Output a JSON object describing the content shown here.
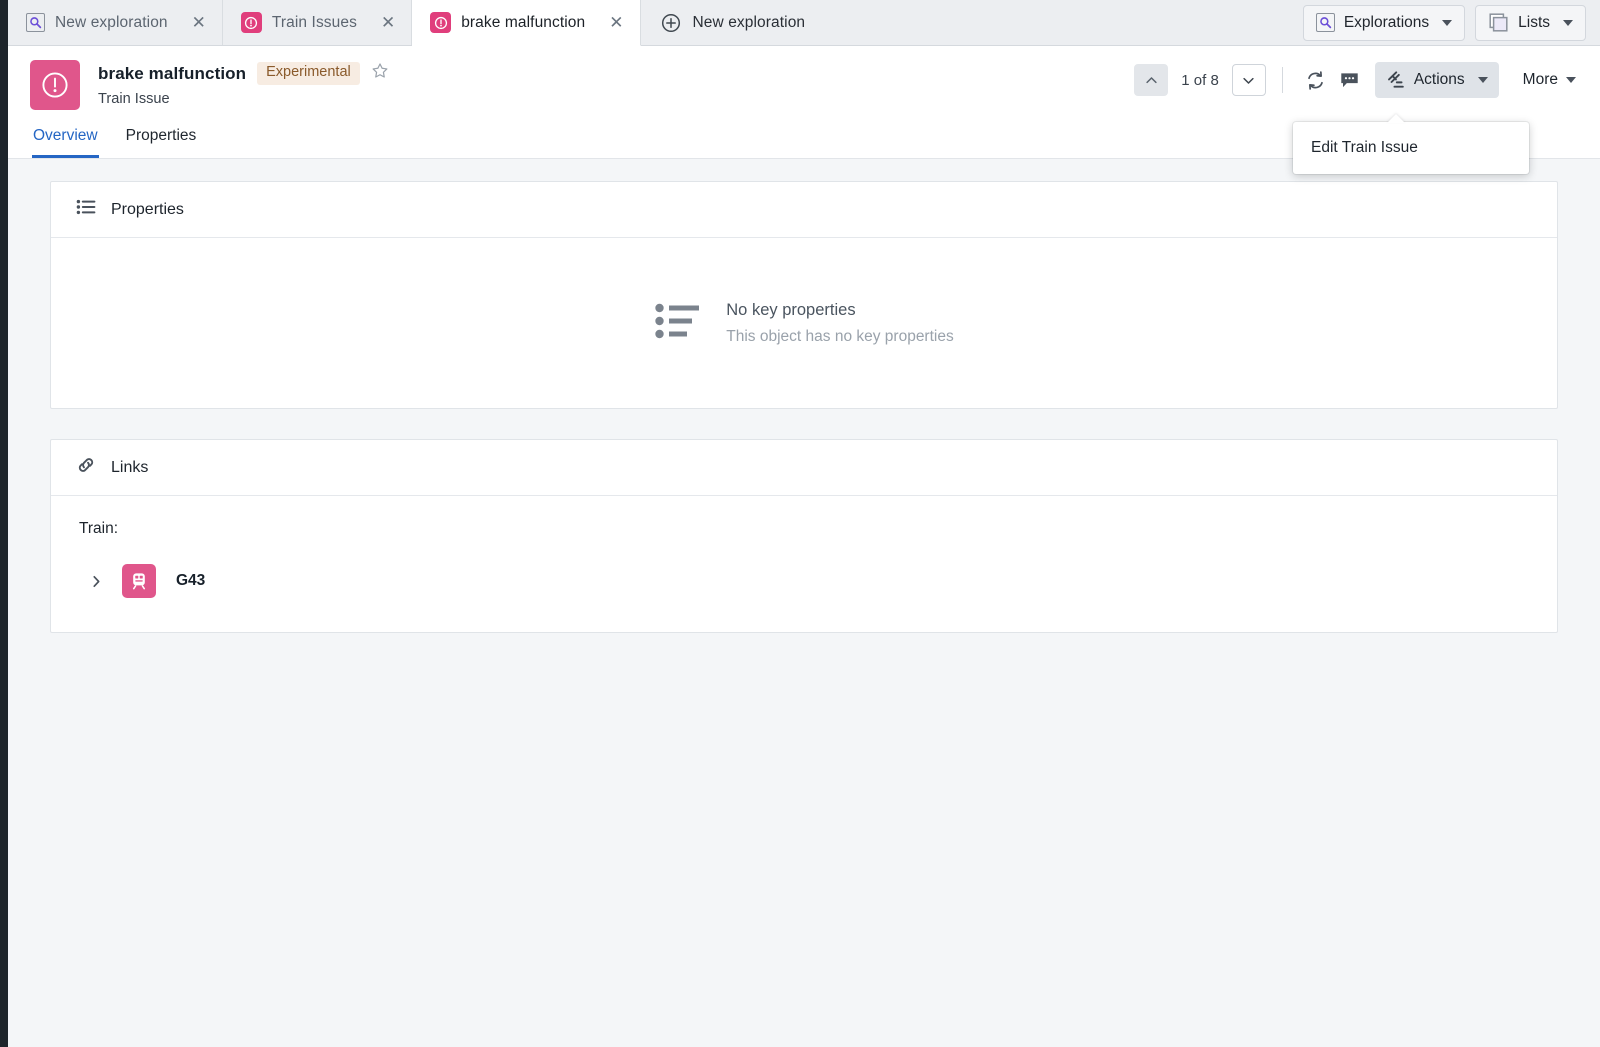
{
  "tabs": [
    {
      "label": "New exploration",
      "icon": "search-square-icon",
      "active": false,
      "closable": true
    },
    {
      "label": "Train Issues",
      "icon": "issue-pink-icon",
      "active": false,
      "closable": true
    },
    {
      "label": "brake malfunction",
      "icon": "issue-pink-icon",
      "active": true,
      "closable": true
    }
  ],
  "new_tab": {
    "label": "New exploration",
    "icon": "plus-circle-icon"
  },
  "tabbar_right": [
    {
      "label": "Explorations",
      "icon": "search-square-icon"
    },
    {
      "label": "Lists",
      "icon": "stack-icon"
    }
  ],
  "object": {
    "title": "brake malfunction",
    "badge": "Experimental",
    "subtitle": "Train Issue",
    "avatar_icon": "exclamation-circle-icon",
    "avatar_color": "#e0568b"
  },
  "toolbar": {
    "prev_label": "Previous object",
    "next_label": "Next object",
    "counter": "1 of 8",
    "refresh_label": "Refresh",
    "comments_label": "Comments",
    "actions_label": "Actions",
    "more_label": "More"
  },
  "actions_menu": {
    "items": [
      {
        "label": "Edit Train Issue"
      }
    ]
  },
  "subtabs": [
    {
      "label": "Overview",
      "active": true
    },
    {
      "label": "Properties",
      "active": false
    }
  ],
  "properties_card": {
    "title": "Properties",
    "icon": "list-icon",
    "empty_title": "No key properties",
    "empty_subtitle": "This object has no key properties",
    "empty_icon": "bullet-list-icon"
  },
  "links_card": {
    "title": "Links",
    "icon": "link-icon",
    "group_label": "Train:",
    "items": [
      {
        "name": "G43",
        "icon": "train-icon",
        "avatar_color": "#e0568b"
      }
    ]
  },
  "colors": {
    "accent_pink": "#e0568b",
    "tab_pink": "#e03e7c",
    "active_blue": "#2566c4",
    "badge_bg": "#f7ece2",
    "badge_text": "#8a5a2b",
    "rail_dark": "#1e252b",
    "page_bg": "#f4f6f8"
  }
}
